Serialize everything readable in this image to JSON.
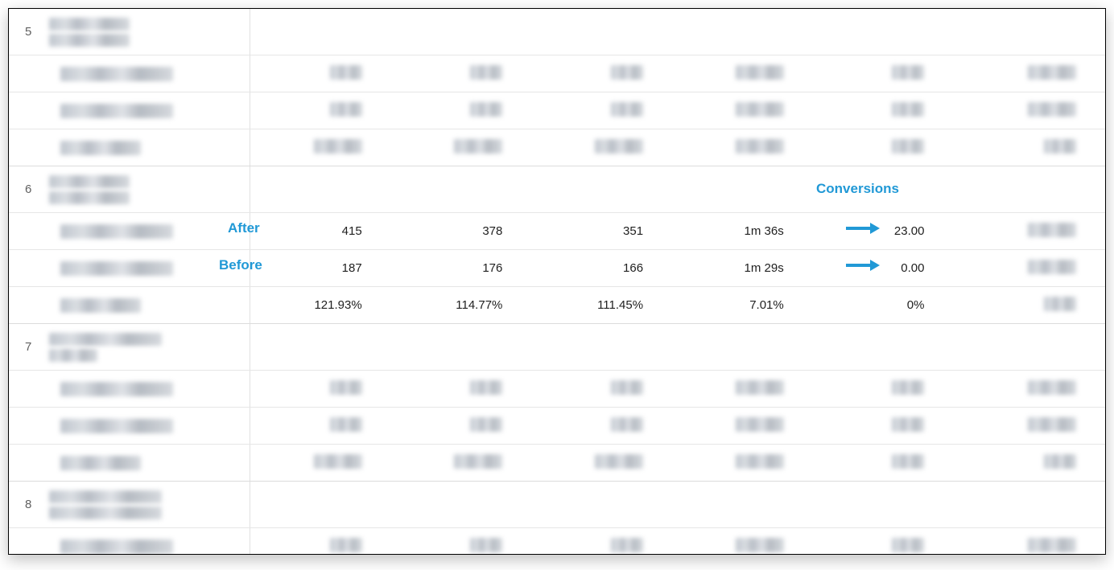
{
  "annotations": {
    "after": "After",
    "before": "Before",
    "conversions": "Conversions"
  },
  "groups": [
    {
      "index": "5"
    },
    {
      "index": "6"
    },
    {
      "index": "7"
    },
    {
      "index": "8"
    }
  ],
  "focus_rows": {
    "after": {
      "c1": "415",
      "c2": "378",
      "c3": "351",
      "c4": "1m 36s",
      "c5": "23.00"
    },
    "before": {
      "c1": "187",
      "c2": "176",
      "c3": "166",
      "c4": "1m 29s",
      "c5": "0.00"
    },
    "pct": {
      "c1": "121.93%",
      "c2": "114.77%",
      "c3": "111.45%",
      "c4": "7.01%",
      "c5": "0%"
    }
  }
}
